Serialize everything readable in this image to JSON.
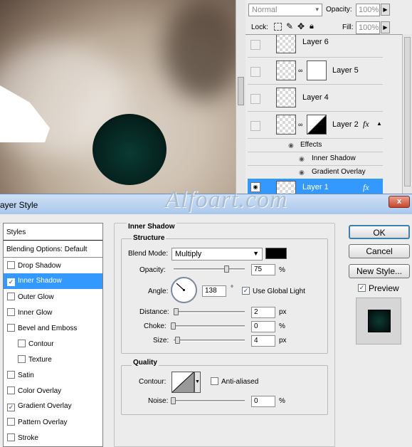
{
  "watermark": "Alfoart.com",
  "layers_panel": {
    "blend_mode": "Normal",
    "opacity_label": "Opacity:",
    "opacity_value": "100%",
    "lock_label": "Lock:",
    "fill_label": "Fill:",
    "fill_value": "100%",
    "layers": [
      {
        "name": "Layer 6"
      },
      {
        "name": "Layer 5"
      },
      {
        "name": "Layer 4"
      },
      {
        "name": "Layer 2"
      },
      {
        "name": "Layer 1"
      }
    ],
    "effects_label": "Effects",
    "effects": [
      "Inner Shadow",
      "Gradient Overlay"
    ],
    "fx_glyph": "fx"
  },
  "dialog": {
    "title": "ayer Style",
    "close_label": "x",
    "styles_header": "Styles",
    "blending_options": "Blending Options: Default",
    "style_items": [
      {
        "label": "Drop Shadow",
        "checked": false
      },
      {
        "label": "Inner Shadow",
        "checked": true
      },
      {
        "label": "Outer Glow",
        "checked": false
      },
      {
        "label": "Inner Glow",
        "checked": false
      },
      {
        "label": "Bevel and Emboss",
        "checked": false
      },
      {
        "label": "Contour",
        "checked": false
      },
      {
        "label": "Texture",
        "checked": false
      },
      {
        "label": "Satin",
        "checked": false
      },
      {
        "label": "Color Overlay",
        "checked": false
      },
      {
        "label": "Gradient Overlay",
        "checked": true
      },
      {
        "label": "Pattern Overlay",
        "checked": false
      },
      {
        "label": "Stroke",
        "checked": false
      }
    ],
    "section_title": "Inner Shadow",
    "structure": {
      "title": "Structure",
      "blend_mode_label": "Blend Mode:",
      "blend_mode_value": "Multiply",
      "shadow_color": "#000000",
      "opacity_label": "Opacity:",
      "opacity_value": "75",
      "opacity_unit": "%",
      "angle_label": "Angle:",
      "angle_value": "138",
      "angle_unit": "°",
      "use_global_light_label": "Use Global Light",
      "use_global_light_checked": true,
      "distance_label": "Distance:",
      "distance_value": "2",
      "distance_unit": "px",
      "choke_label": "Choke:",
      "choke_value": "0",
      "choke_unit": "%",
      "size_label": "Size:",
      "size_value": "4",
      "size_unit": "px"
    },
    "quality": {
      "title": "Quality",
      "contour_label": "Contour:",
      "anti_aliased_label": "Anti-aliased",
      "anti_aliased_checked": false,
      "noise_label": "Noise:",
      "noise_value": "0",
      "noise_unit": "%"
    },
    "buttons": {
      "ok": "OK",
      "cancel": "Cancel",
      "new_style": "New Style...",
      "preview_label": "Preview",
      "preview_checked": true
    }
  }
}
